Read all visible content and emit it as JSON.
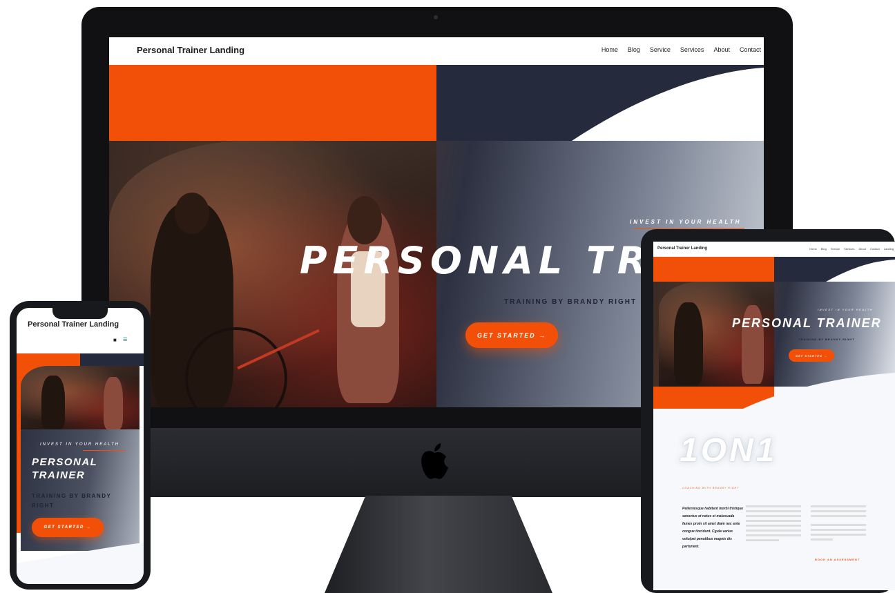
{
  "desktop": {
    "nav": {
      "brand": "Personal Trainer Landing",
      "items": [
        "Home",
        "Blog",
        "Service",
        "Services",
        "About",
        "Contact"
      ]
    },
    "hero": {
      "eyebrow": "INVEST IN YOUR HEALTH",
      "title": "PERSONAL TRAIN",
      "subtitle": "TRAINING BY BRANDY RIGHT",
      "cta": "GET STARTED →"
    }
  },
  "tablet": {
    "nav": {
      "brand": "Personal Trainer Landing",
      "items": [
        "Home",
        "Blog",
        "Service",
        "Services",
        "About",
        "Contact",
        "Landing"
      ]
    },
    "hero": {
      "eyebrow": "INVEST IN YOUR HEALTH",
      "title": "PERSONAL TRAINER",
      "subtitle": "TRAINING BY BRANDY RIGHT",
      "cta": "GET STARTED →"
    },
    "section": {
      "heading": "1ON1",
      "caption": "COACHING WITH BRANDY RIGHT",
      "quote": "Pellentesque habitant morbi tristique senectus et netus et malesuada fames proin sit amet diam nec ante congue tincidunt. Cgula varius volutpat penatibus magnis dis parturient.",
      "cta": "BOOK AN ASSESSMENT"
    }
  },
  "phone": {
    "nav": {
      "brand": "Personal Trainer Landing"
    },
    "hero": {
      "eyebrow": "INVEST IN YOUR HEALTH",
      "title": "PERSONAL TRAINER",
      "subtitle": "TRAINING BY BRANDY RIGHT",
      "cta": "GET STARTED →"
    }
  },
  "colors": {
    "accent": "#f25009",
    "navy": "#252b3c",
    "device": "#18191d"
  },
  "icons": [
    "apple-logo-icon",
    "cart-icon",
    "hamburger-menu-icon",
    "arrow-right-icon"
  ]
}
